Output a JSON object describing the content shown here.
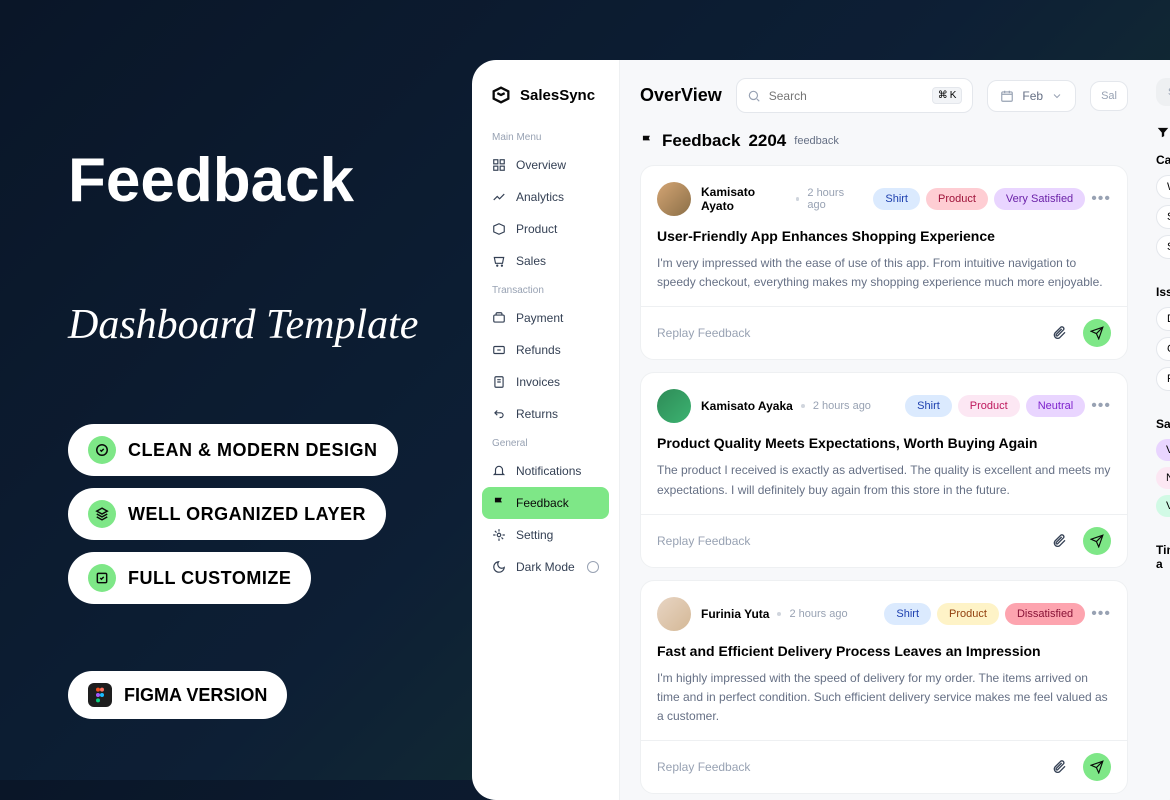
{
  "promo": {
    "title": "Feedback",
    "subtitle": "Dashboard Template",
    "features": [
      "CLEAN & MODERN DESIGN",
      "WELL ORGANIZED LAYER",
      "FULL CUSTOMIZE"
    ],
    "figma": "FIGMA VERSION"
  },
  "brand": "SalesSync",
  "sidebar": {
    "main_label": "Main Menu",
    "main": [
      "Overview",
      "Analytics",
      "Product",
      "Sales"
    ],
    "transaction_label": "Transaction",
    "transaction": [
      "Payment",
      "Refunds",
      "Invoices",
      "Returns"
    ],
    "general_label": "General",
    "general": [
      "Notifications",
      "Feedback",
      "Setting",
      "Dark Mode"
    ]
  },
  "header": {
    "title": "OverView",
    "search_placeholder": "Search",
    "kbd_sym": "⌘",
    "kbd_key": "K",
    "month": "Feb",
    "sale_stub": "Sal"
  },
  "feedback": {
    "title": "Feedback",
    "count": "2204",
    "suffix": "feedback"
  },
  "cards": [
    {
      "user": "Kamisato Ayato",
      "time": "2 hours ago",
      "tags": [
        "Shirt",
        "Product",
        "Very Satisfied"
      ],
      "title": "User-Friendly App Enhances Shopping Experience",
      "body": "I'm very impressed with the ease of use of this app. From intuitive navigation to speedy checkout, everything makes my shopping experience much more enjoyable.",
      "replay": "Replay Feedback"
    },
    {
      "user": "Kamisato Ayaka",
      "time": "2 hours ago",
      "tags": [
        "Shirt",
        "Product",
        "Neutral"
      ],
      "title": "Product Quality Meets Expectations, Worth Buying Again",
      "body": "The product I received is exactly as advertised. The quality is excellent and meets my expectations. I will definitely buy again from this store in the future.",
      "replay": "Replay Feedback"
    },
    {
      "user": "Furinia Yuta",
      "time": "2 hours ago",
      "tags": [
        "Shirt",
        "Product",
        "Dissatisfied"
      ],
      "title": "Fast and Efficient Delivery Process Leaves an Impression",
      "body": "I'm highly impressed with the speed of delivery for my order. The items arrived on time and in perfect condition. Such efficient delivery service makes me feel valued as a customer.",
      "replay": "Replay Feedback"
    }
  ],
  "filters": {
    "search": "Search",
    "title": "Fi",
    "category_label": "Categ",
    "category": [
      "Weat",
      "Snick",
      "Swea"
    ],
    "issue_label": "Issue",
    "issue": [
      "Deliv",
      "Cust",
      "Retur"
    ],
    "satisfaction_label": "Satisf",
    "satisfaction": [
      "Very",
      "Neut",
      "Very"
    ],
    "time_label": "Time a"
  }
}
